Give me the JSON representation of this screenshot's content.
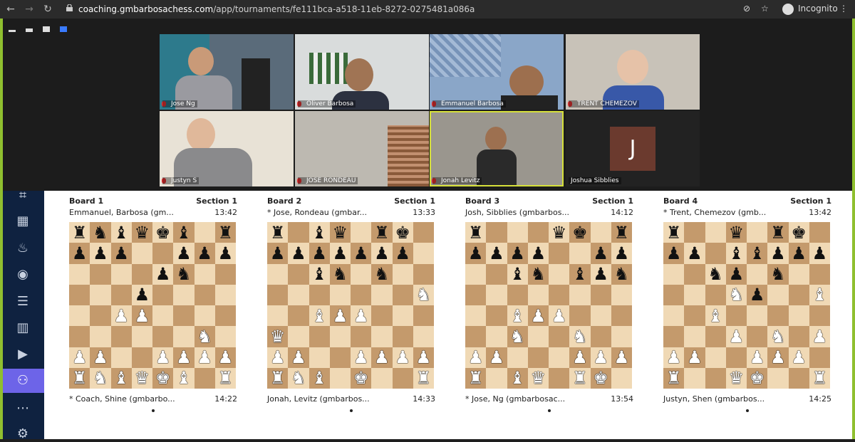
{
  "browser": {
    "url_host": "coaching.gmbarbosachess.com",
    "url_path": "/app/tournaments/fe111bca-a518-11eb-8272-0275481a086a",
    "incognito_label": "Incognito"
  },
  "zoom": {
    "participants": [
      {
        "name": "Jose Ng"
      },
      {
        "name": "Oliver Barbosa"
      },
      {
        "name": "Emmanuel Barbosa"
      },
      {
        "name": "TRENT CHEMEZOV"
      },
      {
        "name": "Justyn S"
      },
      {
        "name": "JOSE RONDEAU"
      },
      {
        "name": "Jonah Levitz"
      },
      {
        "name": "Joshua Sibblies",
        "initial": "J"
      }
    ]
  },
  "boards": [
    {
      "title": "Board 1",
      "section": "Section 1",
      "top_player": "Emmanuel, Barbosa (gm...",
      "top_clock": "13:42",
      "bottom_player": "* Coach, Shine (gmbarbo...",
      "bottom_clock": "14:22",
      "fen": [
        "rnbqkb.r",
        "ppp..ppp",
        "....pn..",
        "...p....",
        "..PP....",
        "......N.",
        "PP..PPPP",
        "RNBQKB.R"
      ]
    },
    {
      "title": "Board 2",
      "section": "Section 1",
      "top_player": "* Jose, Rondeau (gmbar...",
      "top_clock": "13:33",
      "bottom_player": "Jonah, Levitz (gmbarbos...",
      "bottom_clock": "14:33",
      "fen": [
        "r.bq.rk.",
        "ppppppp.",
        "..bn.n..",
        ".......N",
        "..BPP...",
        "Q.......",
        "PP..PPPP",
        "RNB.K..R"
      ]
    },
    {
      "title": "Board 3",
      "section": "Section 1",
      "top_player": "Josh, Sibblies (gmbarbos...",
      "top_clock": "14:12",
      "bottom_player": "* Jose, Ng (gmbarbosac...",
      "bottom_clock": "13:54",
      "fen": [
        "r...qk.r",
        "pppp..pp",
        "..bn.bpn",
        "........",
        "..BPP...",
        "..N..N..",
        "PP...PPP",
        "R.BQ.RK."
      ]
    },
    {
      "title": "Board 4",
      "section": "Section 1",
      "top_player": "* Trent, Chemezov (gmb...",
      "top_clock": "13:42",
      "bottom_player": "Justyn, Shen (gmbarbos...",
      "bottom_clock": "14:25",
      "fen": [
        "r..q.rk.",
        "pp.bbppp",
        "..np.n..",
        "...Np..B",
        "..B.....",
        "...P.N.P",
        "PP..PPP.",
        "R..QK..R"
      ]
    }
  ]
}
